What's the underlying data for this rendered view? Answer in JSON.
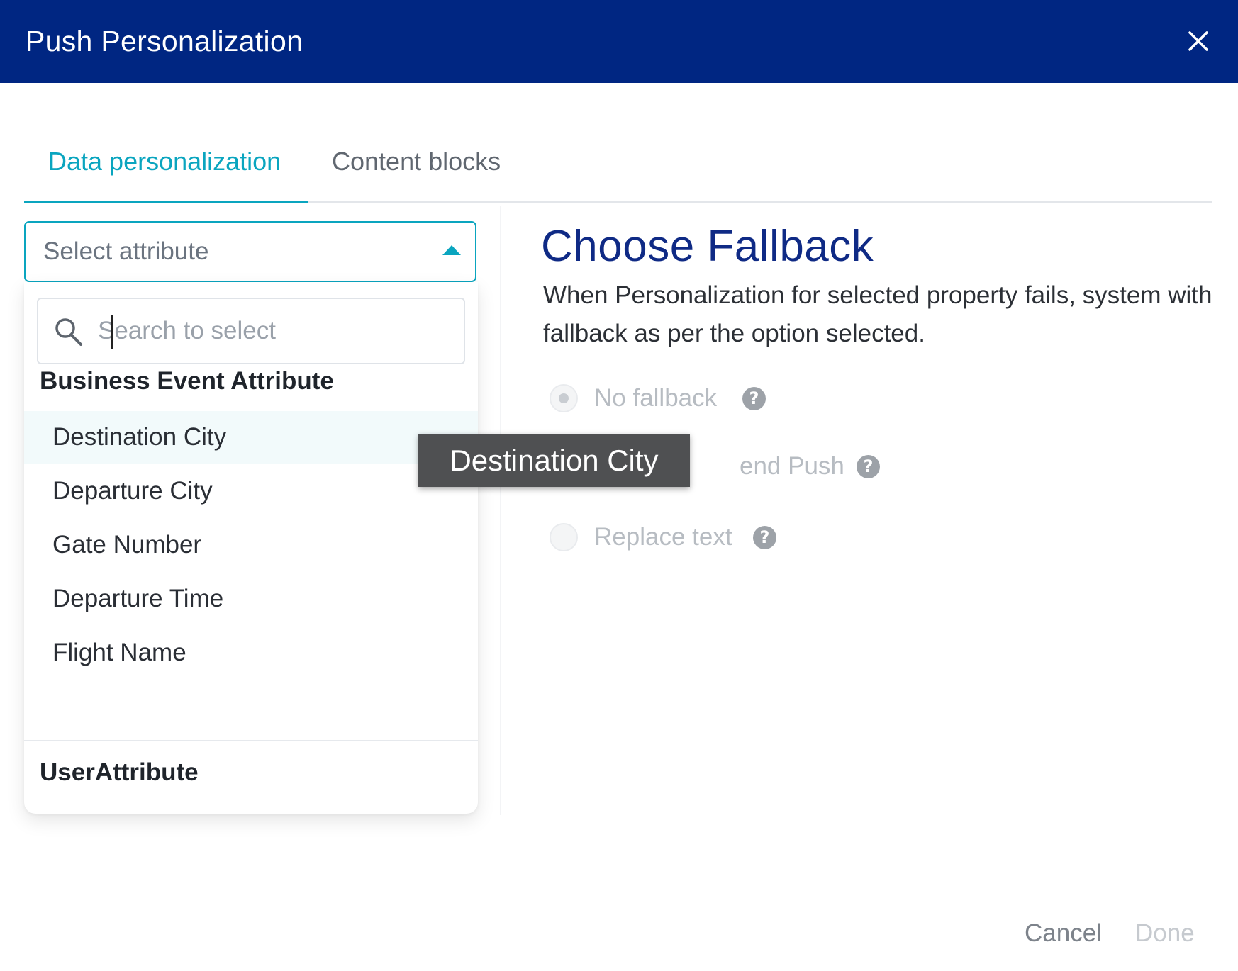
{
  "modal": {
    "title": "Push Personalization",
    "close_icon": "close-icon"
  },
  "tabs": [
    {
      "label": "Data personalization",
      "active": true
    },
    {
      "label": "Content blocks",
      "active": false
    }
  ],
  "attribute_select": {
    "placeholder": "Select attribute",
    "expanded": true,
    "caret_icon": "caret-up-icon"
  },
  "dropdown": {
    "search": {
      "placeholder": "Search to select",
      "value": "",
      "icon": "search-icon"
    },
    "groups": [
      {
        "heading": "Business Event Attribute",
        "options": [
          "Destination City",
          "Departure City",
          "Gate Number",
          "Departure Time",
          "Flight Name"
        ]
      },
      {
        "heading": "UserAttribute",
        "options": []
      }
    ],
    "hovered_option": "Destination City"
  },
  "tooltip": {
    "text": "Destination City"
  },
  "fallback": {
    "title": "Choose Fallback",
    "description": "When Personalization for selected property fails, system with fallback as per the option selected.",
    "options": [
      {
        "label": "No fallback",
        "selected": true,
        "disabled": true
      },
      {
        "label": "end Push",
        "selected": false,
        "disabled": true
      },
      {
        "label": "Replace text",
        "selected": false,
        "disabled": true
      }
    ],
    "help_glyph": "?"
  },
  "footer": {
    "cancel_label": "Cancel",
    "done_label": "Done"
  },
  "colors": {
    "header_bg": "#002682",
    "accent": "#0aa5bf",
    "title_blue": "#0f2a85",
    "tooltip_bg": "#4f5052"
  }
}
